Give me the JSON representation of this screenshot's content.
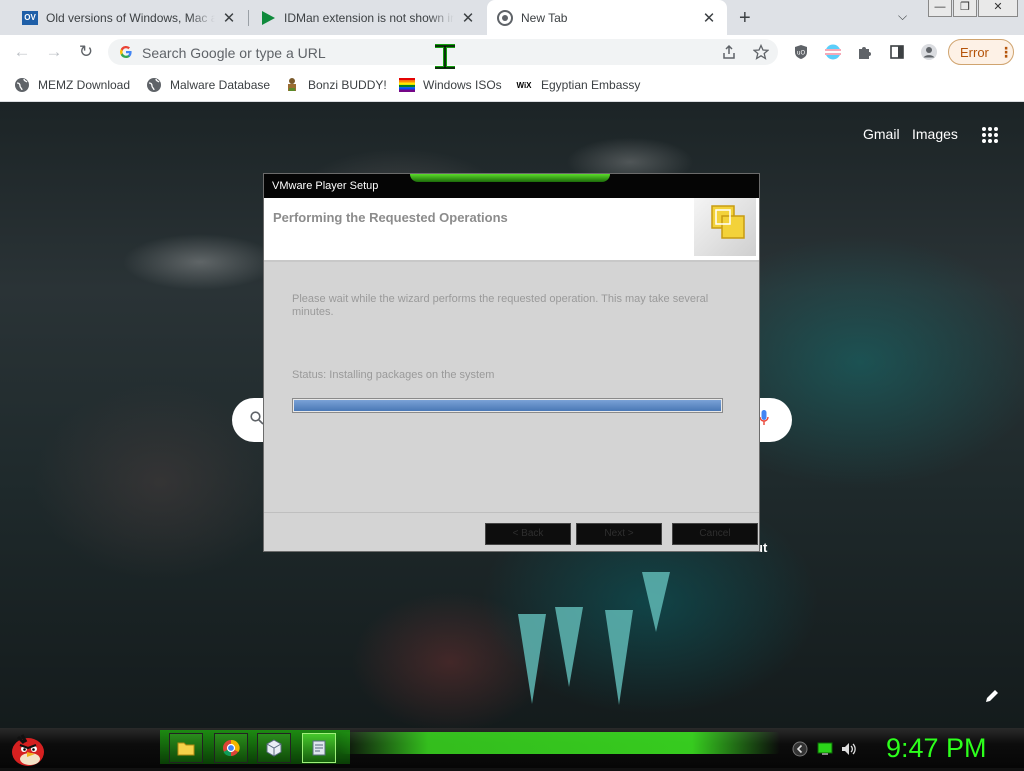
{
  "browser": {
    "tabs": [
      {
        "title": "Old versions of Windows, Mac and Linux",
        "favicon": "ov-icon",
        "active": false
      },
      {
        "title": "IDMan extension is not shown in Chrome",
        "favicon": "play-icon",
        "active": false
      },
      {
        "title": "New Tab",
        "favicon": "chrome-icon",
        "active": true
      }
    ],
    "omnibox_placeholder": "Search Google or type a URL",
    "error_label": "Error",
    "bookmarks": [
      {
        "label": "MEMZ Download",
        "icon": "globe-icon"
      },
      {
        "label": "Malware Database",
        "icon": "globe-icon"
      },
      {
        "label": "Bonzi BUDDY!",
        "icon": "bonzi-icon"
      },
      {
        "label": "Windows ISOs",
        "icon": "rainbow-flag-icon"
      },
      {
        "label": "Egyptian Embassy",
        "icon": "wix-icon"
      }
    ],
    "wix_text": "WiX",
    "ov_text": "OV"
  },
  "ntp": {
    "gmail": "Gmail",
    "images": "Images",
    "shortcut_fragment": "ut"
  },
  "dialog": {
    "title": "VMware Player Setup",
    "heading": "Performing the Requested Operations",
    "message": "Please wait while the wizard performs the requested operation. This may take several minutes.",
    "status": "Status: Installing packages on the system",
    "progress_fraction": 1.0,
    "buttons": [
      "< Back",
      "Next >",
      "Cancel"
    ]
  },
  "taskbar": {
    "clock": "9:47 PM",
    "pinned": [
      "folder-icon",
      "chrome-icon",
      "vmware-box-icon",
      "setup-icon"
    ]
  },
  "colors": {
    "accent_green": "#2dff1c",
    "progress_blue": "#4a78b6",
    "error_orange": "#b45309"
  }
}
